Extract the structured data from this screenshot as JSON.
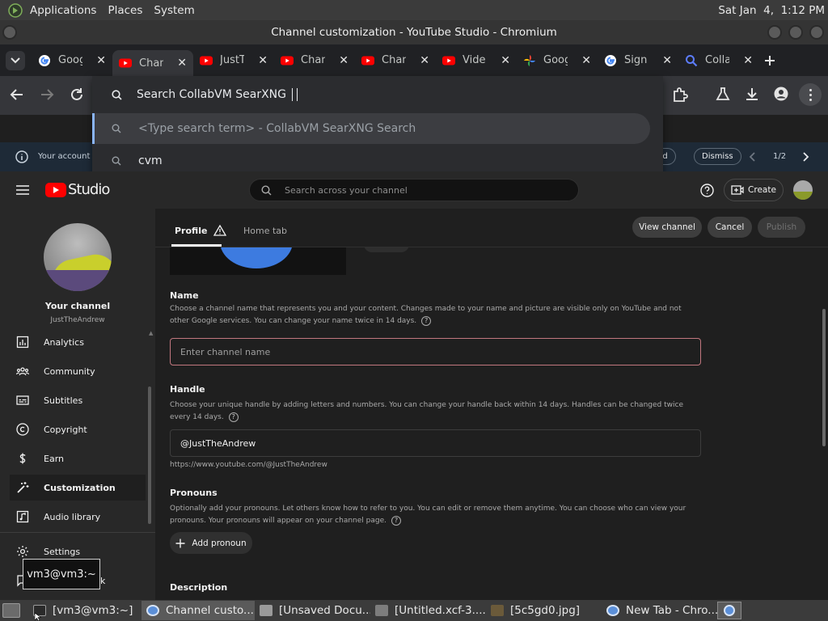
{
  "system_panel": {
    "menus": [
      "Applications",
      "Places",
      "System"
    ],
    "clock": "Sat Jan  4,  1:12 PM"
  },
  "window": {
    "title": "Channel customization - YouTube Studio - Chromium"
  },
  "tabs": [
    {
      "title": "Goog",
      "icon": "google-icon",
      "active": false
    },
    {
      "title": "Chan",
      "icon": "youtube-icon",
      "active": true
    },
    {
      "title": "JustT",
      "icon": "youtube-icon",
      "active": false
    },
    {
      "title": "Chan",
      "icon": "youtube-icon",
      "active": false
    },
    {
      "title": "Chan",
      "icon": "youtube-icon",
      "active": false
    },
    {
      "title": "Vide",
      "icon": "youtube-icon",
      "active": false
    },
    {
      "title": "Goog",
      "icon": "google-photos-icon",
      "active": false
    },
    {
      "title": "Sign",
      "icon": "google-icon",
      "active": false
    },
    {
      "title": "Colla",
      "icon": "search-icon",
      "active": false
    }
  ],
  "omnibox": {
    "value": "Search CollabVM SearXNG",
    "suggestions": [
      {
        "text": "<Type search term> - CollabVM SearXNG Search",
        "selected": true
      },
      {
        "text": "cvm",
        "selected": false
      }
    ]
  },
  "infobar": {
    "text": "Your account is",
    "get_started": "arted",
    "dismiss": "Dismiss",
    "pager": "1/2"
  },
  "studio": {
    "logo_text": "Studio",
    "search_placeholder": "Search across your channel",
    "create_label": "Create"
  },
  "sidebar": {
    "channel_label": "Your channel",
    "channel_handle": "JustTheAndrew",
    "items": [
      {
        "label": "Analytics",
        "icon": "analytics-icon"
      },
      {
        "label": "Community",
        "icon": "community-icon"
      },
      {
        "label": "Subtitles",
        "icon": "subtitles-icon"
      },
      {
        "label": "Copyright",
        "icon": "copyright-icon"
      },
      {
        "label": "Earn",
        "icon": "dollar-icon"
      },
      {
        "label": "Customization",
        "icon": "magic-wand-icon",
        "active": true
      },
      {
        "label": "Audio library",
        "icon": "audio-library-icon"
      }
    ],
    "settings_label": "Settings",
    "feedback_partial": "k"
  },
  "page": {
    "tabs": [
      "Profile",
      "Home tab"
    ],
    "view_channel": "View channel",
    "cancel": "Cancel",
    "publish": "Publish",
    "name_heading": "Name",
    "name_desc": "Choose a channel name that represents you and your content. Changes made to your name and picture are visible only on YouTube and not other Google services. You can change your name twice in 14 days.",
    "name_placeholder": "Enter channel name",
    "handle_heading": "Handle",
    "handle_desc": "Choose your unique handle by adding letters and numbers. You can change your handle back within 14 days. Handles can be changed twice every 14 days.",
    "handle_value": "@JustTheAndrew",
    "handle_url": "https://www.youtube.com/@JustTheAndrew",
    "pronouns_heading": "Pronouns",
    "pronouns_desc": "Optionally add your pronouns. Let others know how to refer to you. You can edit or remove them anytime. You can choose who can view your pronouns. Your pronouns will appear on your channel page.",
    "add_pronoun": "Add pronoun",
    "description_heading": "Description"
  },
  "tooltip": "vm3@vm3:~",
  "taskbar": [
    {
      "label": "[vm3@vm3:~]",
      "icon": "terminal-icon"
    },
    {
      "label": "Channel custo...",
      "icon": "chromium-icon",
      "active": true
    },
    {
      "label": "[Unsaved Docu...",
      "icon": "text-editor-icon"
    },
    {
      "label": "[Untitled.xcf-3....",
      "icon": "gimp-icon"
    },
    {
      "label": "[5c5gd0.jpg]",
      "icon": "image-viewer-icon"
    },
    {
      "label": "New Tab - Chro...",
      "icon": "chromium-icon"
    }
  ],
  "colors": {
    "youtube_red": "#ff0000",
    "focus_border": "#8ab4f8",
    "name_field_border": "#c2777f"
  }
}
